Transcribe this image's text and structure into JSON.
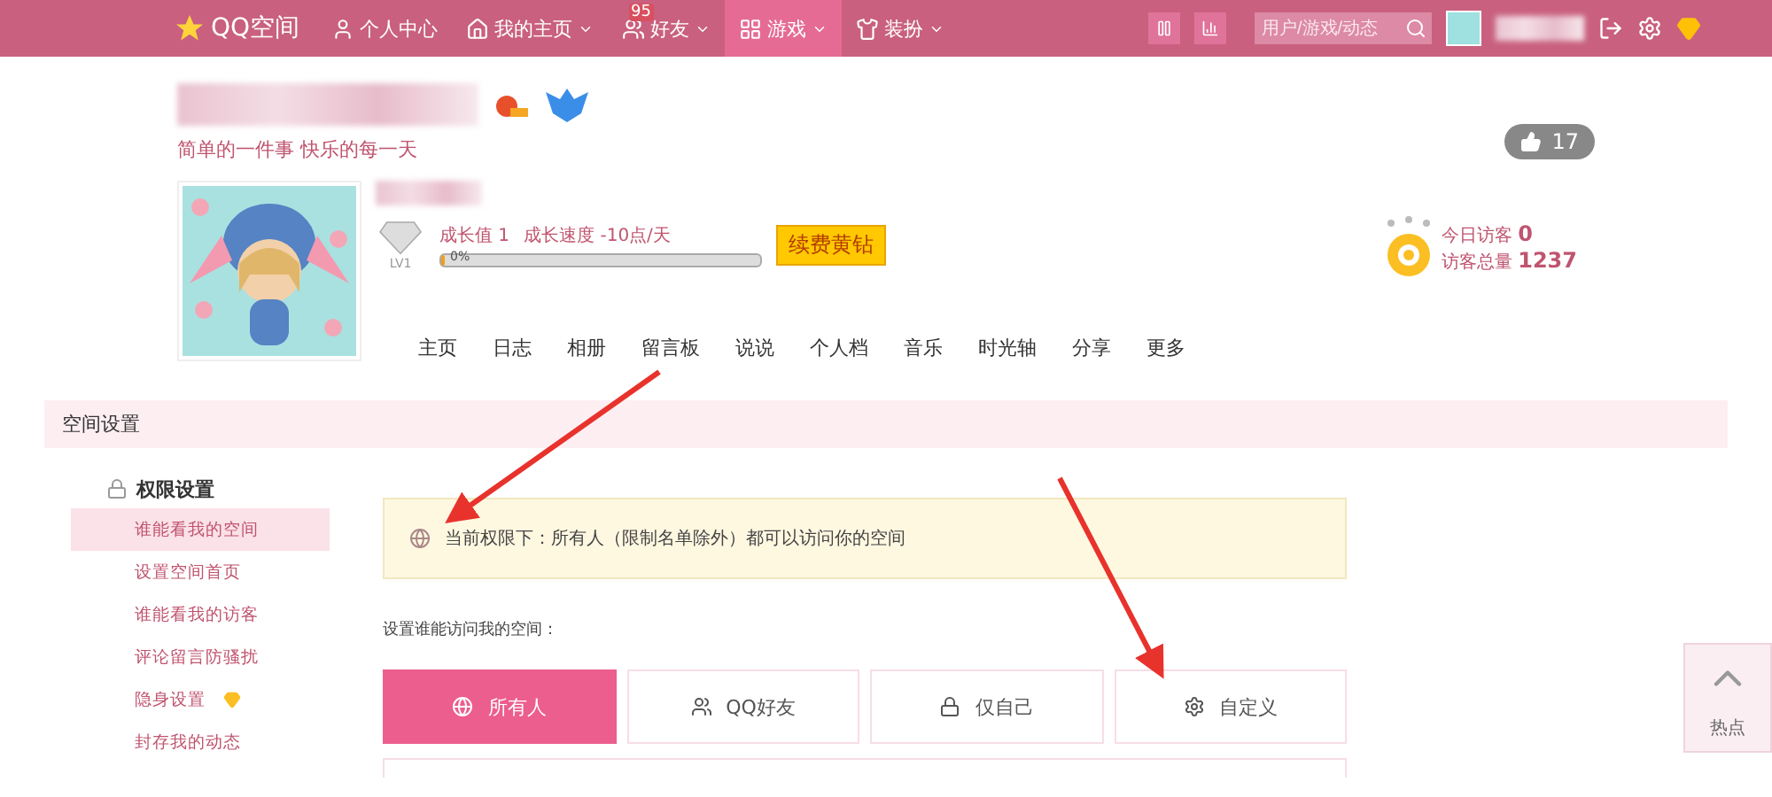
{
  "topbar": {
    "logo": "QQ空间",
    "nav": [
      {
        "kind": "person",
        "label": "个人中心",
        "dropdown": false,
        "selected": false
      },
      {
        "kind": "home",
        "label": "我的主页",
        "dropdown": true,
        "selected": false
      },
      {
        "kind": "friends",
        "label": "好友",
        "badge": "95",
        "dropdown": true,
        "selected": false
      },
      {
        "kind": "games",
        "label": "游戏",
        "dropdown": true,
        "selected": true
      },
      {
        "kind": "shirt",
        "label": "装扮",
        "dropdown": true,
        "selected": false
      }
    ],
    "search": {
      "placeholder": "用户/游戏/动态"
    }
  },
  "profile": {
    "tagline": "简单的一件事 快乐的每一天",
    "growth": "成长值 1",
    "speed": "成长速度 -10点/天",
    "level_badge": "LV1",
    "progress": {
      "label": "0%",
      "level": 0
    },
    "renew_button": "续费黄钻",
    "likes": "17",
    "visitors": [
      {
        "label": "今日访客",
        "value": "0"
      },
      {
        "label": "访客总量",
        "value": "1237"
      }
    ],
    "tabs": [
      "主页",
      "日志",
      "相册",
      "留言板",
      "说说",
      "个人档",
      "音乐",
      "时光轴",
      "分享",
      "更多"
    ]
  },
  "settings": {
    "title": "空间设置",
    "section": "权限设置",
    "items": [
      {
        "label": "谁能看我的空间",
        "selected": true,
        "vip": false
      },
      {
        "label": "设置空间首页",
        "selected": false,
        "vip": false
      },
      {
        "label": "谁能看我的访客",
        "selected": false,
        "vip": false
      },
      {
        "label": "评论留言防骚扰",
        "selected": false,
        "vip": false
      },
      {
        "label": "隐身设置",
        "selected": false,
        "vip": true
      },
      {
        "label": "封存我的动态",
        "selected": false,
        "vip": false
      }
    ],
    "notice": "当前权限下：所有人（限制名单除外）都可以访问你的空间",
    "prompt": "设置谁能访问我的空间：",
    "options": [
      {
        "kind": "globe",
        "label": "所有人",
        "selected": true
      },
      {
        "kind": "friends",
        "label": "QQ好友",
        "selected": false
      },
      {
        "kind": "lock",
        "label": "仅自己",
        "selected": false
      },
      {
        "kind": "gear",
        "label": "自定义",
        "selected": false
      }
    ]
  },
  "hotspot": "热点"
}
